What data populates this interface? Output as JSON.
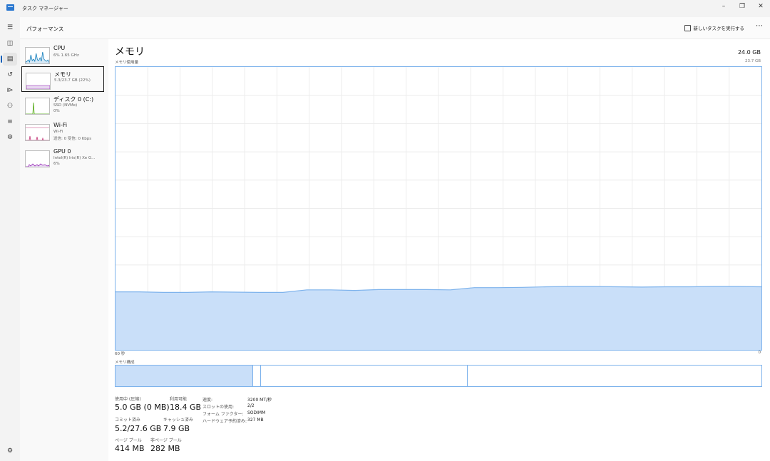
{
  "window": {
    "title": "タスク マネージャー"
  },
  "header": {
    "title": "パフォーマンス",
    "run_task": "新しいタスクを実行する"
  },
  "nav": {
    "items": [
      "hamburger-icon",
      "processes-icon",
      "performance-icon",
      "history-icon",
      "startup-icon",
      "users-icon",
      "details-icon",
      "services-icon"
    ],
    "settings": "settings-icon"
  },
  "resources": [
    {
      "name": "CPU",
      "sub1": "6%  1.65 GHz",
      "sub2": "",
      "color": "#117dbb"
    },
    {
      "name": "メモリ",
      "sub1": "5.3/23.7 GB (22%)",
      "sub2": "",
      "color": "#8b12ae"
    },
    {
      "name": "ディスク 0 (C:)",
      "sub1": "SSD (NVMe)",
      "sub2": "0%",
      "color": "#4da60c"
    },
    {
      "name": "Wi-Fi",
      "sub1": "Wi-Fi",
      "sub2": "送信: 0  受信: 0 Kbps",
      "color": "#a74f01"
    },
    {
      "name": "GPU 0",
      "sub1": "Intel(R) Iris(R) Xe G...",
      "sub2": "6%",
      "color": "#8b12ae"
    }
  ],
  "memory": {
    "title": "メモリ",
    "total": "24.0 GB",
    "usage_label": "メモリ使用量",
    "max_label": "23.7 GB",
    "time_left": "60 秒",
    "time_right": "0",
    "composition_label": "メモリ構成",
    "usage_percent": [
      20.5,
      20.5,
      20.3,
      20.3,
      20.5,
      20.4,
      20.3,
      20.3,
      21.2,
      21.2,
      21.0,
      21.3,
      21.3,
      21.3,
      21.2,
      22.0,
      22.0,
      22.1,
      22.3,
      22.4,
      22.4,
      22.3,
      22.2,
      22.3,
      22.3,
      22.4,
      22.4,
      22.3
    ],
    "composition": {
      "in_use": 0.213,
      "modified": 0.012,
      "standby": 0.32,
      "free": 0.455
    },
    "colors": {
      "fill": "#c9dff9",
      "line": "#7eb3ec",
      "grid": "#ececec"
    },
    "stats": {
      "in_use_label": "使用中 (圧縮)",
      "in_use_value": "5.0 GB (0 MB)",
      "available_label": "利用可能",
      "available_value": "18.4 GB",
      "committed_label": "コミット済み",
      "committed_value": "5.2/27.6 GB",
      "cached_label": "キャッシュ済み",
      "cached_value": "7.9 GB",
      "paged_label": "ページ プール",
      "paged_value": "414 MB",
      "nonpaged_label": "非ページ プール",
      "nonpaged_value": "282 MB",
      "speed_label": "速度:",
      "speed_value": "3200 MT/秒",
      "slots_label": "スロットの使用:",
      "slots_value": "2/2",
      "form_label": "フォーム ファクター:",
      "form_value": "SODIMM",
      "reserved_label": "ハードウェア予約済み:",
      "reserved_value": "327 MB"
    }
  }
}
